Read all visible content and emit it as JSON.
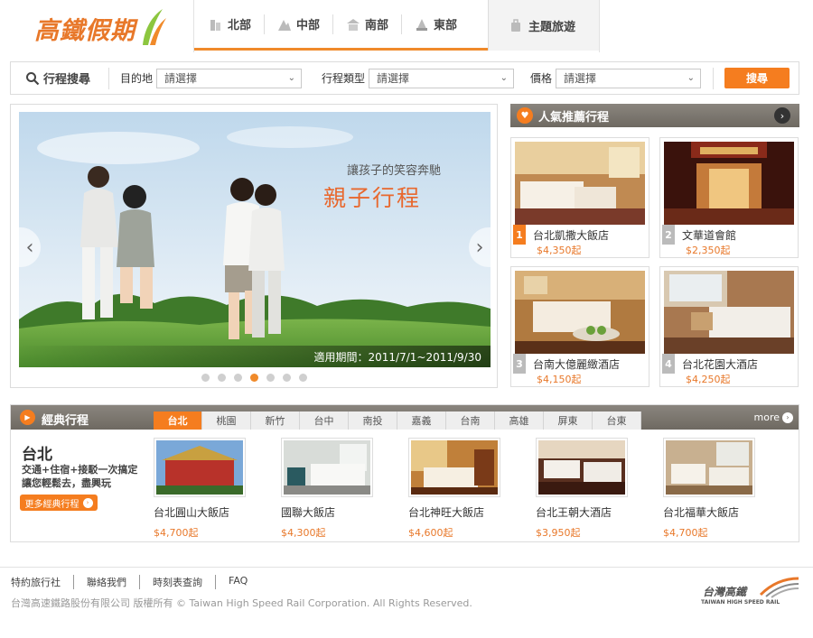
{
  "brand": {
    "logo_text": "高鐵假期"
  },
  "nav": {
    "regions": [
      {
        "label": "北部",
        "icon": "building-icon"
      },
      {
        "label": "中部",
        "icon": "mountain-icon"
      },
      {
        "label": "南部",
        "icon": "temple-icon"
      },
      {
        "label": "東部",
        "icon": "wave-icon"
      }
    ],
    "theme": {
      "label": "主題旅遊",
      "icon": "bag-icon"
    }
  },
  "search": {
    "title": "行程搜尋",
    "destination_label": "目的地",
    "destination_value": "請選擇",
    "type_label": "行程類型",
    "type_value": "請選擇",
    "price_label": "價格",
    "price_value": "請選擇",
    "button_label": "搜尋"
  },
  "banner": {
    "subtitle": "讓孩子的笑容奔馳",
    "title": "親子行程",
    "period": "適用期間：2011/7/1~2011/9/30",
    "slide_count": 7,
    "active_slide": 4
  },
  "popular": {
    "title": "人氣推薦行程",
    "items": [
      {
        "rank": "1",
        "name": "台北凱撒大飯店",
        "price": "$4,350起"
      },
      {
        "rank": "2",
        "name": "文華道會館",
        "price": "$2,350起"
      },
      {
        "rank": "3",
        "name": "台南大億麗緻酒店",
        "price": "$4,150起"
      },
      {
        "rank": "4",
        "name": "台北花園大酒店",
        "price": "$4,250起"
      }
    ]
  },
  "classic": {
    "title": "經典行程",
    "more_label": "more",
    "tabs": [
      "台北",
      "桃園",
      "新竹",
      "台中",
      "南投",
      "嘉義",
      "台南",
      "高雄",
      "屏東",
      "台東"
    ],
    "active_tab": 0,
    "city": {
      "name": "台北",
      "desc_line1": "交通+住宿+接駁一次搞定",
      "desc_line2": "讓您輕鬆去，盡興玩",
      "button_label": "更多經典行程"
    },
    "hotels": [
      {
        "name": "台北圓山大飯店",
        "price": "$4,700起"
      },
      {
        "name": "國聯大飯店",
        "price": "$4,300起"
      },
      {
        "name": "台北神旺大飯店",
        "price": "$4,600起"
      },
      {
        "name": "台北王朝大酒店",
        "price": "$3,950起"
      },
      {
        "name": "台北福華大飯店",
        "price": "$4,700起"
      }
    ]
  },
  "footer": {
    "links": [
      "特約旅行社",
      "聯絡我們",
      "時刻表查詢",
      "FAQ"
    ],
    "copyright": "台灣高速鐵路股份有限公司 版權所有 © Taiwan High Speed Rail Corporation. All Rights Reserved.",
    "partner_logo_cn": "台灣高鐵",
    "partner_logo_en": "TAIWAN HIGH SPEED RAIL"
  },
  "colors": {
    "accent": "#f57d1f",
    "bar": "#7a756d",
    "price": "#e8782a"
  }
}
